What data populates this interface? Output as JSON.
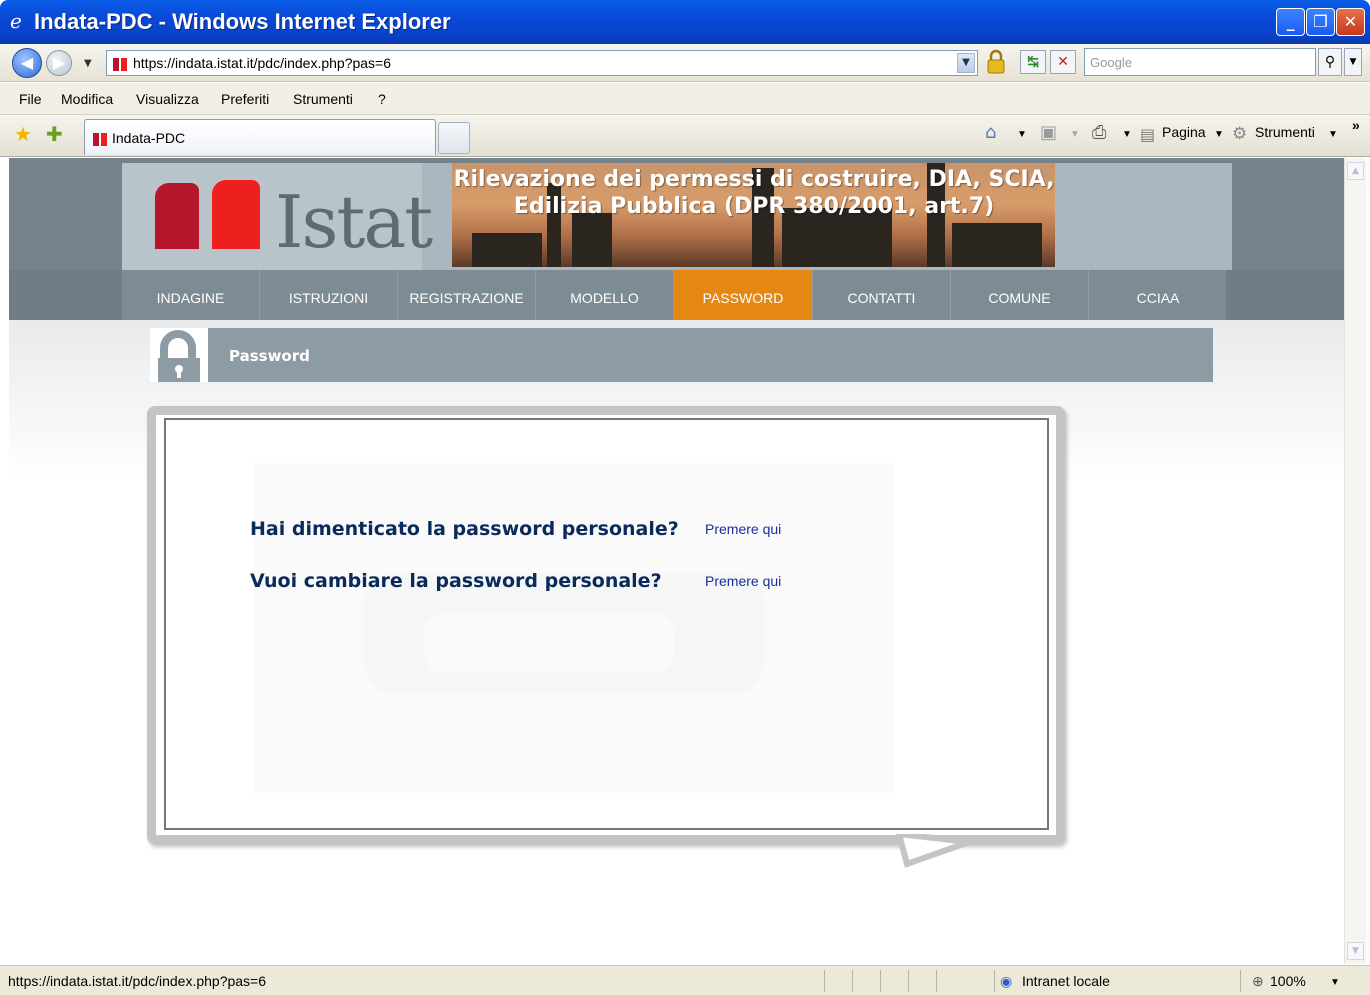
{
  "window": {
    "title": "Indata-PDC - Windows Internet Explorer",
    "minimize_label": "_",
    "maximize_label": "❐",
    "close_label": "✕"
  },
  "address": {
    "url": "https://indata.istat.it/pdc/index.php?pas=6",
    "search_placeholder": "Google"
  },
  "menu": [
    "File",
    "Modifica",
    "Visualizza",
    "Preferiti",
    "Strumenti",
    "?"
  ],
  "tab": {
    "label": "Indata-PDC"
  },
  "commands": {
    "page": "Pagina",
    "tools": "Strumenti",
    "more": "»"
  },
  "site": {
    "logo_text": "Istat",
    "banner_title": "Rilevazione dei permessi di costruire, DIA, SCIA, Edilizia Pubblica (DPR 380/2001, art.7)",
    "nav": [
      "INDAGINE",
      "ISTRUZIONI",
      "REGISTRAZIONE",
      "MODELLO",
      "PASSWORD",
      "CONTATTI",
      "COMUNE",
      "CCIAA"
    ],
    "active_nav": "PASSWORD",
    "section_title": "Password",
    "questions": [
      {
        "text": "Hai dimenticato la password personale?",
        "link": "Premere qui"
      },
      {
        "text": "Vuoi cambiare la password personale?",
        "link": "Premere qui"
      }
    ]
  },
  "status": {
    "url": "https://indata.istat.it/pdc/index.php?pas=6",
    "zone": "Intranet locale",
    "zoom": "100%"
  },
  "colors": {
    "accent_nav": "#e58713",
    "header": "#73828b",
    "link": "#1a2e9a",
    "question": "#0b2a5c"
  }
}
